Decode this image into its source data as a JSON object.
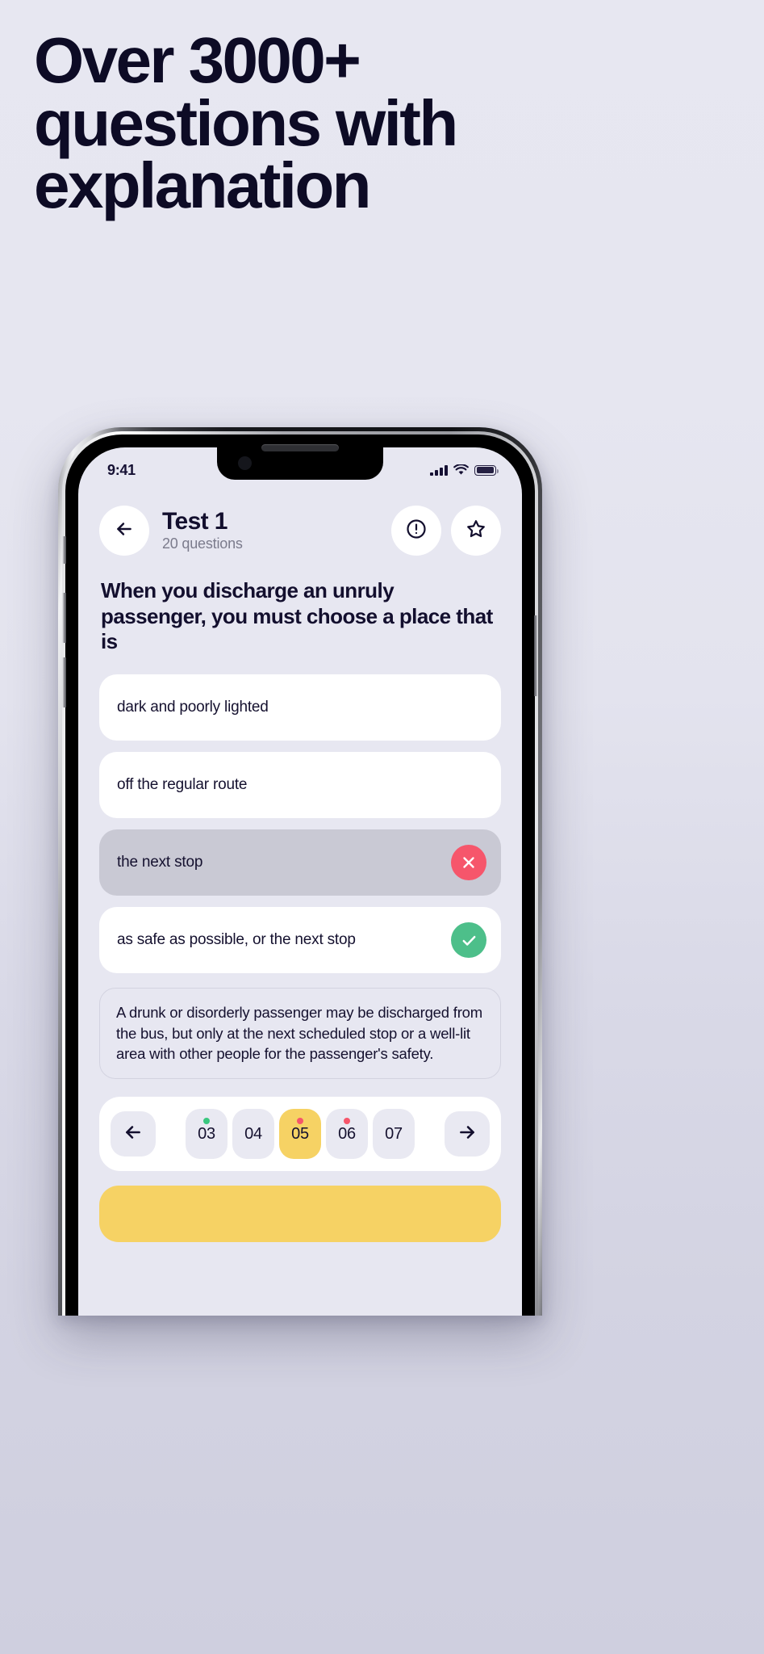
{
  "promo": {
    "headline_lines": [
      "Over 3000+",
      "questions with",
      "explanation"
    ],
    "headline_color": "#0d0b25",
    "background_color": "#e6e6f0"
  },
  "status_bar": {
    "time": "9:41",
    "icons": [
      "cellular-signal",
      "wifi",
      "battery"
    ]
  },
  "app_bar": {
    "back_icon": "arrow-left-icon",
    "title": "Test 1",
    "subtitle": "20 questions",
    "report_icon": "exclamation-circle-icon",
    "favorite_icon": "star-icon"
  },
  "quiz": {
    "question": "When you discharge an unruly passenger, you must choose a place that is",
    "options": [
      {
        "label": "dark and poorly lighted",
        "state": "default",
        "badge": ""
      },
      {
        "label": "off the regular route",
        "state": "default",
        "badge": ""
      },
      {
        "label": "the next stop",
        "state": "wrong",
        "badge": "close-icon"
      },
      {
        "label": "as safe as possible, or the next stop",
        "state": "correct",
        "badge": "check-icon"
      }
    ],
    "explanation": "A drunk or disorderly passenger may be discharged from the bus, but only at the next scheduled stop or a well-lit area with other people for the passenger's safety.",
    "colors": {
      "wrong": "#f6566b",
      "correct": "#4dbf8a",
      "active": "#f6d264",
      "wrong_card": "#c9c9d4"
    }
  },
  "pager": {
    "prev_icon": "arrow-left-icon",
    "next_icon": "arrow-right-icon",
    "items": [
      {
        "number": "03",
        "marker": "correct",
        "active": false
      },
      {
        "number": "04",
        "marker": "none",
        "active": false
      },
      {
        "number": "05",
        "marker": "wrong",
        "active": true
      },
      {
        "number": "06",
        "marker": "wrong",
        "active": false
      },
      {
        "number": "07",
        "marker": "none",
        "active": false
      }
    ]
  }
}
